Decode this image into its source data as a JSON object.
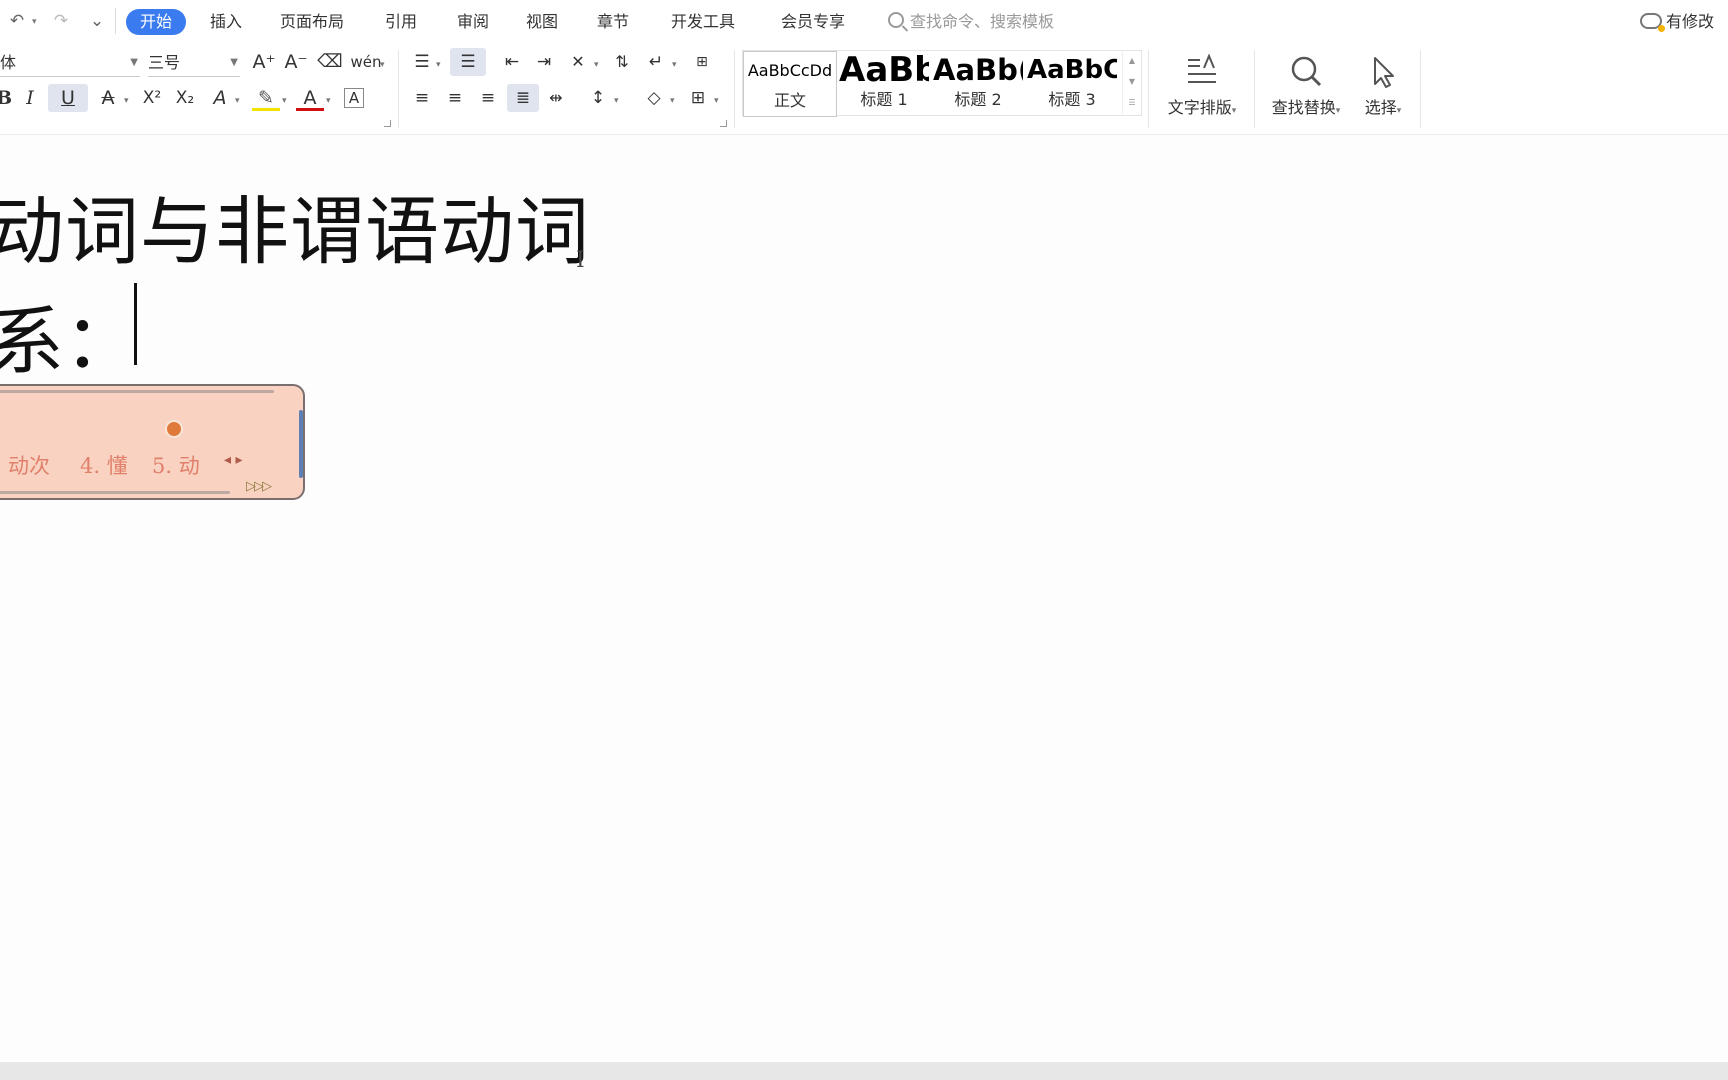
{
  "quick_access": {
    "undo": "↶",
    "redo": "↷",
    "more": "⌄"
  },
  "tabs": [
    "开始",
    "插入",
    "页面布局",
    "引用",
    "审阅",
    "视图",
    "章节",
    "开发工具",
    "会员专享"
  ],
  "search": {
    "placeholder": "查找命令、搜索模板"
  },
  "cloud_status": "有修改",
  "font": {
    "name": "体",
    "size": "三号"
  },
  "font_buttons": {
    "grow": "A⁺",
    "shrink": "A⁻",
    "phonetic": "wén",
    "bold": "B",
    "italic": "I",
    "underline": "U",
    "strike": "A",
    "superscript": "X²",
    "subscript": "X₂",
    "effect": "A",
    "highlight": "✎",
    "color": "A",
    "char_border": "A"
  },
  "styles": [
    {
      "preview": "AaBbCcDd",
      "name": "正文"
    },
    {
      "preview": "AaBb",
      "name": "标题 1"
    },
    {
      "preview": "AaBb(",
      "name": "标题 2"
    },
    {
      "preview": "AaBbC",
      "name": "标题 3"
    }
  ],
  "tools": {
    "text_layout": "文字排版",
    "find_replace": "查找替换",
    "select": "选择"
  },
  "document": {
    "line1": "动词与非谓语动词",
    "line2": "系："
  },
  "ime": {
    "candidates": [
      "动次",
      "4. 懂",
      "5. 动"
    ],
    "more": "▷▷▷"
  },
  "colors": {
    "accent": "#3a7bf0",
    "ime_bg": "#f9d2c2",
    "ime_text": "#e0806b"
  }
}
